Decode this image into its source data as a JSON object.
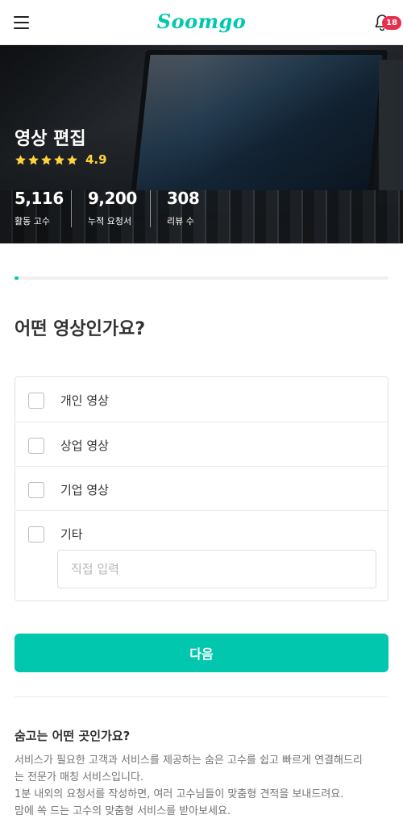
{
  "header": {
    "logo": "Soomgo",
    "notification_count": "18"
  },
  "hero": {
    "title": "영상 편집",
    "rating_stars": 5,
    "rating": "4.9",
    "stats": [
      {
        "value": "5,116",
        "label": "활동 고수"
      },
      {
        "value": "9,200",
        "label": "누적 요청서"
      },
      {
        "value": "308",
        "label": "리뷰 수"
      }
    ]
  },
  "progress": {
    "fraction": 0.01
  },
  "question": "어떤 영상인가요?",
  "options": [
    {
      "label": "개인 영상",
      "checked": false
    },
    {
      "label": "상업 영상",
      "checked": false
    },
    {
      "label": "기업 영상",
      "checked": false
    },
    {
      "label": "기타",
      "checked": false
    }
  ],
  "other_input": {
    "placeholder": "직접 입력",
    "value": ""
  },
  "next_button": "다음",
  "about": {
    "title": "숨고는 어떤 곳인가요?",
    "lines": [
      "서비스가 필요한 고객과 서비스를 제공하는 숨은 고수를 쉽고 빠르게 연결해드리",
      "는 전문가 매칭 서비스입니다.",
      "1분 내외의 요청서를 작성하면, 여러 고수님들이 맞춤형 견적을 보내드려요.",
      "맘에 쏙 드는 고수의 맞춤형 서비스를 받아보세요."
    ]
  },
  "colors": {
    "brand": "#00c7ae",
    "badge": "#e8304e",
    "star": "#ffd43b"
  },
  "icons": {
    "menu": "hamburger-menu-icon",
    "bell": "bell-icon",
    "star": "star-icon"
  }
}
